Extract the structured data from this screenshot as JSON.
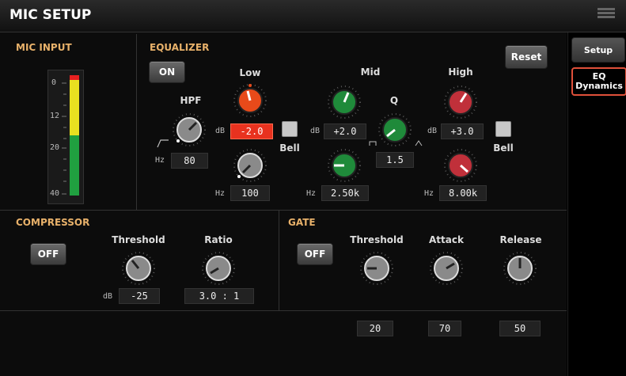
{
  "title": "MIC SETUP",
  "mic_input": {
    "label": "MIC INPUT",
    "scale": [
      "0",
      "12",
      "20",
      "40"
    ]
  },
  "equalizer": {
    "label": "EQUALIZER",
    "on_label": "ON",
    "reset_label": "Reset",
    "hpf": {
      "label": "HPF",
      "unit": "Hz",
      "value": "80"
    },
    "low": {
      "label": "Low",
      "gain_unit": "dB",
      "gain": "-2.0",
      "freq_unit": "Hz",
      "freq": "100",
      "type": "Bell"
    },
    "mid": {
      "label": "Mid",
      "gain_unit": "dB",
      "gain": "+2.0",
      "freq_unit": "Hz",
      "freq": "2.50k",
      "q_label": "Q",
      "q": "1.5"
    },
    "high": {
      "label": "High",
      "gain_unit": "dB",
      "gain": "+3.0",
      "freq_unit": "Hz",
      "freq": "8.00k",
      "type": "Bell"
    }
  },
  "compressor": {
    "label": "COMPRESSOR",
    "state_label": "OFF",
    "threshold_label": "Threshold",
    "threshold_unit": "dB",
    "threshold": "-25",
    "ratio_label": "Ratio",
    "ratio": "3.0 : 1"
  },
  "gate": {
    "label": "GATE",
    "state_label": "OFF",
    "threshold_label": "Threshold",
    "threshold": "20",
    "attack_label": "Attack",
    "attack": "70",
    "release_label": "Release",
    "release": "50"
  },
  "sidebar": {
    "tabs": [
      {
        "label": "Setup"
      },
      {
        "label_line1": "EQ",
        "label_line2": "Dynamics"
      }
    ]
  },
  "colors": {
    "accent": "#e8b16a",
    "red": "#e8321f",
    "green_knob": "#1f8a3a",
    "red_knob": "#c0303a",
    "orange_knob": "#e84a1a",
    "gray_knob": "#8a8a8a"
  },
  "icons": {
    "menu": "list-icon"
  }
}
